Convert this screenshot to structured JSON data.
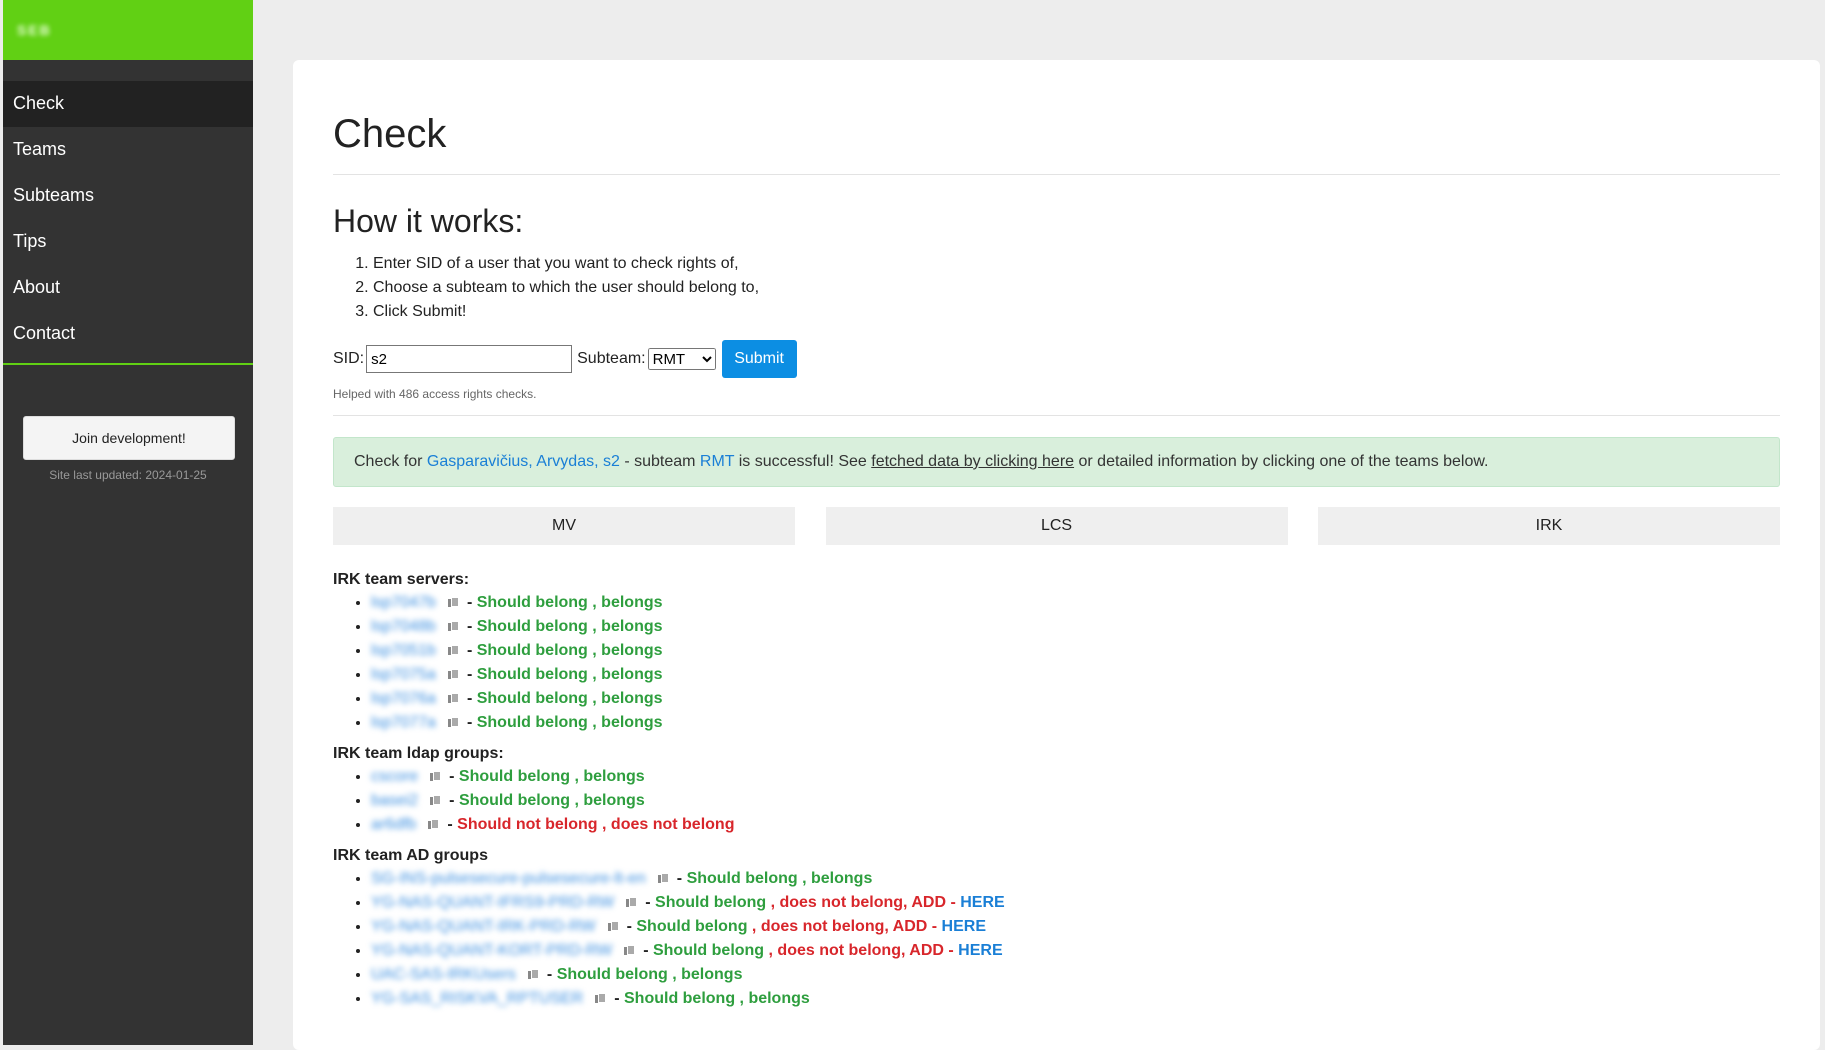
{
  "brand": {
    "logo_text": "SEB"
  },
  "nav": {
    "items": [
      {
        "label": "Check"
      },
      {
        "label": "Teams"
      },
      {
        "label": "Subteams"
      },
      {
        "label": "Tips"
      },
      {
        "label": "About"
      },
      {
        "label": "Contact"
      }
    ],
    "join_button": "Join development!",
    "last_updated": "Site last updated: 2024-01-25"
  },
  "page": {
    "title": "Check",
    "how_title": "How it works:",
    "steps": [
      "Enter SID of a user that you want to check rights of,",
      "Choose a subteam to which the user should belong to,",
      "Click Submit!"
    ]
  },
  "form": {
    "sid_label": "SID:",
    "sid_value": "s2",
    "subteam_label": "Subteam:",
    "subteam_selected": "RMT",
    "submit_label": "Submit",
    "helped_text": "Helped with 486 access rights checks."
  },
  "alert": {
    "prefix": "Check for ",
    "user_name": "Gasparavičius, Arvydas, s2",
    "mid1": " - subteam ",
    "subteam": "RMT",
    "mid2": " is successful! See ",
    "link": "fetched data by clicking here",
    "suffix": " or detailed information by clicking one of the teams below."
  },
  "teams": [
    "MV",
    "LCS",
    "IRK"
  ],
  "sections": {
    "servers": {
      "title": "IRK team servers:",
      "items": [
        {
          "name": "lsp7047b",
          "status": "Should belong",
          "result": "belongs"
        },
        {
          "name": "lsp7048b",
          "status": "Should belong",
          "result": "belongs"
        },
        {
          "name": "lsp7051b",
          "status": "Should belong",
          "result": "belongs"
        },
        {
          "name": "lsp7075a",
          "status": "Should belong",
          "result": "belongs"
        },
        {
          "name": "lsp7076a",
          "status": "Should belong",
          "result": "belongs"
        },
        {
          "name": "lsp7077a",
          "status": "Should belong",
          "result": "belongs"
        }
      ]
    },
    "ldap": {
      "title": "IRK team ldap groups:",
      "items": [
        {
          "name": "cscore",
          "status": "Should belong",
          "result": "belongs"
        },
        {
          "name": "basei2",
          "status": "Should belong",
          "result": "belongs"
        },
        {
          "name": "ar6dfb",
          "status": "Should not belong",
          "result": "does not belong"
        }
      ]
    },
    "ad": {
      "title": "IRK team AD groups",
      "items": [
        {
          "name": "SG-INS-pulsesecure-pulsesecure-lt-en",
          "status": "Should belong",
          "result": "belongs",
          "add": ""
        },
        {
          "name": "YG-NAS-QUANT-IFRS9-PRD-RW",
          "status": "Should belong",
          "result": "does not belong, ADD",
          "add": "HERE"
        },
        {
          "name": "YG-NAS-QUANT-IRK-PRD-RW",
          "status": "Should belong",
          "result": "does not belong, ADD",
          "add": "HERE"
        },
        {
          "name": "YG-NAS-QUANT-KORT-PRD-RW",
          "status": "Should belong",
          "result": "does not belong, ADD",
          "add": "HERE"
        },
        {
          "name": "UAC-SAS-IRKUsers",
          "status": "Should belong",
          "result": "belongs",
          "add": ""
        },
        {
          "name": "YG-SAS_RISKVA_RPTUSER",
          "status": "Should belong",
          "result": "belongs",
          "add": ""
        }
      ]
    }
  }
}
